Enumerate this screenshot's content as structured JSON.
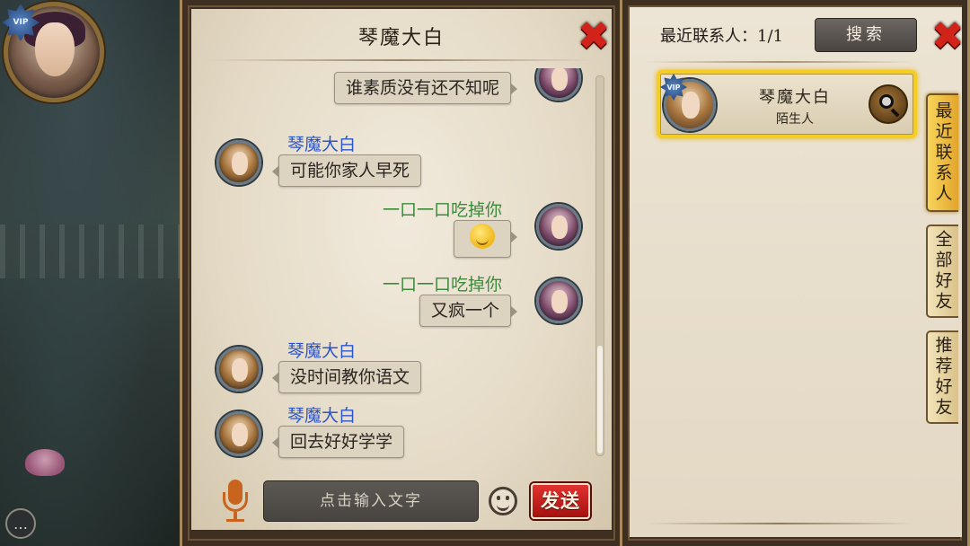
{
  "player": {
    "vip_label": "VIP"
  },
  "chat": {
    "title": "琴魔大白",
    "close_icon": "✖",
    "messages": [
      {
        "side": "mine",
        "name": "",
        "text": "谁素质没有还不知呢",
        "type": "text"
      },
      {
        "side": "peer",
        "name": "琴魔大白",
        "text": "可能你家人早死",
        "type": "text"
      },
      {
        "side": "mine",
        "name": "一口一口吃掉你",
        "text": "",
        "type": "emoji",
        "emoji_name": "shy-smile-emoji"
      },
      {
        "side": "mine",
        "name": "一口一口吃掉你",
        "text": "又疯一个",
        "type": "text"
      },
      {
        "side": "peer",
        "name": "琴魔大白",
        "text": "没时间教你语文",
        "type": "text"
      },
      {
        "side": "peer",
        "name": "琴魔大白",
        "text": "回去好好学学",
        "type": "text"
      }
    ],
    "input": {
      "placeholder": "点击输入文字",
      "send_label": "发送"
    }
  },
  "contacts": {
    "recent_label": "最近联系人：1/1",
    "search_label": "搜索",
    "close_icon": "✖",
    "list": [
      {
        "name": "琴魔大白",
        "status": "陌生人",
        "vip_label": "VIP"
      }
    ],
    "tabs": [
      {
        "label": "最近联系人",
        "active": true
      },
      {
        "label": "全部好友",
        "active": false
      },
      {
        "label": "推荐好友",
        "active": false
      }
    ]
  },
  "colors": {
    "mine_name": "#3c8a3a",
    "peer_name": "#2c55c9",
    "send_button": "#c8201e",
    "highlight_border": "#f6cd22"
  }
}
